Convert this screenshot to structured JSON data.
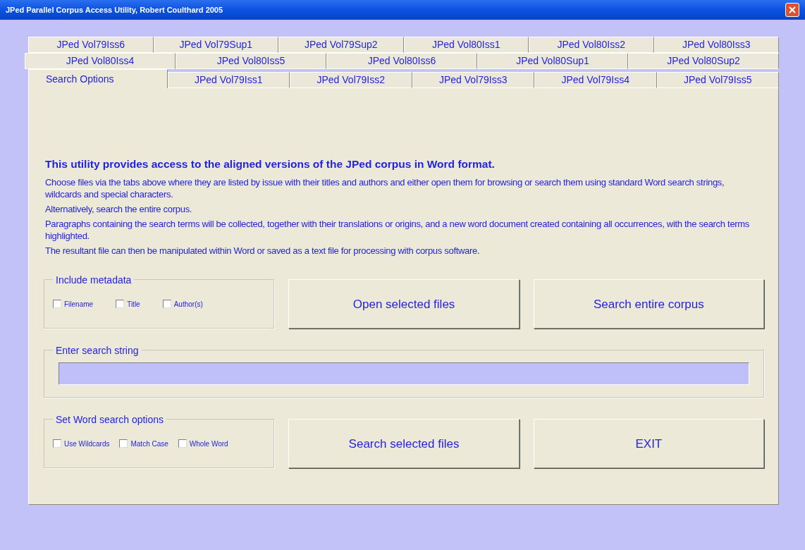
{
  "window": {
    "title": "JPed Parallel Corpus Access Utility, Robert Coulthard 2005"
  },
  "tab_rows": [
    [
      {
        "label": "JPed Vol79Iss6",
        "selected": false
      },
      {
        "label": "JPed Vol79Sup1",
        "selected": false
      },
      {
        "label": "JPed Vol79Sup2",
        "selected": false
      },
      {
        "label": "JPed Vol80Iss1",
        "selected": false
      },
      {
        "label": "JPed Vol80Iss2",
        "selected": false
      },
      {
        "label": "JPed Vol80Iss3",
        "selected": false
      }
    ],
    [
      {
        "label": "JPed Vol80Iss4",
        "selected": false
      },
      {
        "label": "JPed Vol80Iss5",
        "selected": false
      },
      {
        "label": "JPed Vol80Iss6",
        "selected": false
      },
      {
        "label": "JPed Vol80Sup1",
        "selected": false
      },
      {
        "label": "JPed Vol80Sup2",
        "selected": false
      }
    ],
    [
      {
        "label": "Search Options",
        "selected": true
      },
      {
        "label": "JPed Vol79Iss1",
        "selected": false
      },
      {
        "label": "JPed Vol79Iss2",
        "selected": false
      },
      {
        "label": "JPed Vol79Iss3",
        "selected": false
      },
      {
        "label": "JPed Vol79Iss4",
        "selected": false
      },
      {
        "label": "JPed Vol79Iss5",
        "selected": false
      }
    ]
  ],
  "heading": "This utility provides access to the aligned versions of the JPed corpus in Word format.",
  "paragraphs": [
    "Choose files via the tabs above where they are listed by issue with their titles and authors and either open them for browsing or search them using standard Word search strings, wildcards and special characters.",
    "Alternatively, search the entire corpus.",
    "Paragraphs containing the search terms will be collected, together with their translations or origins, and a new word document created containing all occurrences, with the search terms highlighted.",
    "The resultant file can then be manipulated within Word or saved as a text file for processing with corpus software."
  ],
  "metadata": {
    "legend": "Include metadata",
    "options": [
      {
        "label": "Filename",
        "checked": false
      },
      {
        "label": "Title",
        "checked": false
      },
      {
        "label": "Author(s)",
        "checked": false
      }
    ]
  },
  "search": {
    "legend": "Enter search string"
  },
  "word_options": {
    "legend": "Set Word search options",
    "options": [
      {
        "label": "Use Wildcards",
        "checked": false
      },
      {
        "label": "Match Case",
        "checked": false
      },
      {
        "label": "Whole Word",
        "checked": false
      }
    ]
  },
  "buttons": {
    "open": "Open selected files",
    "search_all": "Search entire corpus",
    "search_selected": "Search selected files",
    "exit": "EXIT"
  }
}
